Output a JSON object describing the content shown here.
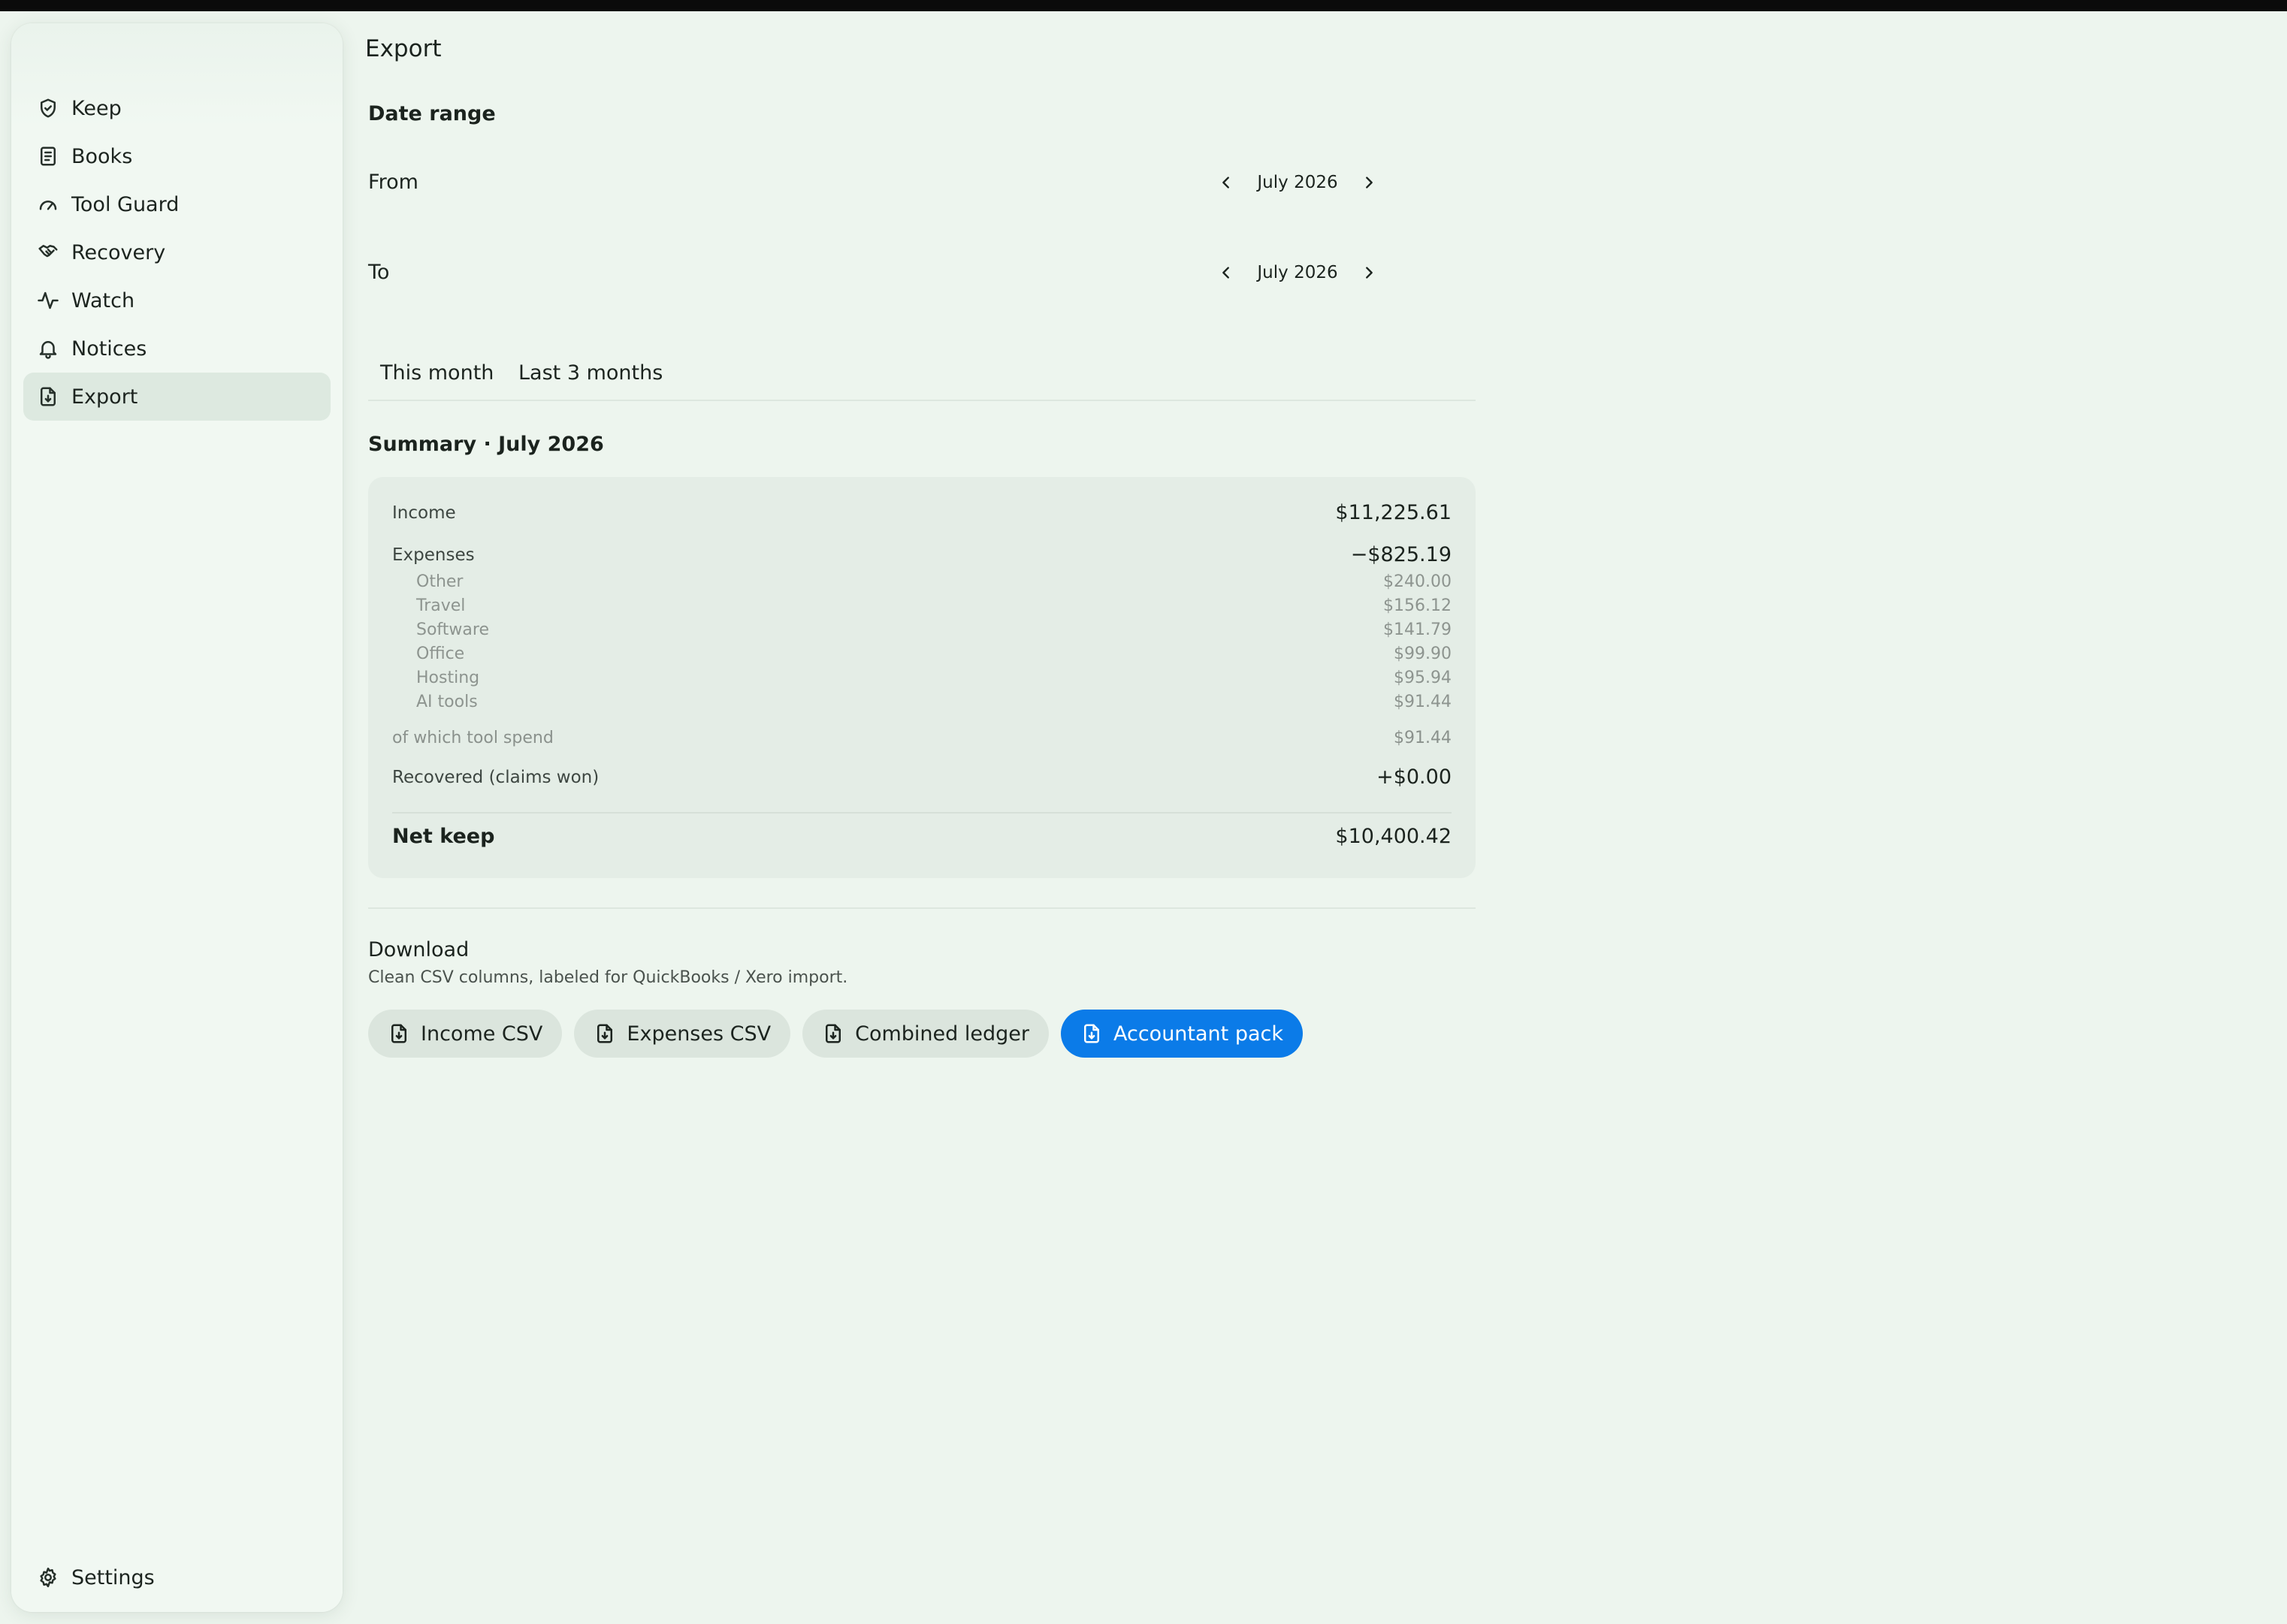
{
  "sidebar": {
    "items": [
      {
        "label": "Keep",
        "icon": "shield-check-icon"
      },
      {
        "label": "Books",
        "icon": "book-icon"
      },
      {
        "label": "Tool Guard",
        "icon": "gauge-icon"
      },
      {
        "label": "Recovery",
        "icon": "handshake-icon"
      },
      {
        "label": "Watch",
        "icon": "activity-icon"
      },
      {
        "label": "Notices",
        "icon": "bell-icon"
      },
      {
        "label": "Export",
        "icon": "file-download-icon",
        "active": true
      }
    ],
    "settings_label": "Settings"
  },
  "page": {
    "title": "Export"
  },
  "date_range": {
    "title": "Date range",
    "from_label": "From",
    "from_value": "July 2026",
    "to_label": "To",
    "to_value": "July 2026",
    "presets": [
      "This month",
      "Last 3 months"
    ]
  },
  "summary": {
    "title": "Summary · July 2026",
    "income_label": "Income",
    "income_value": "$11,225.61",
    "expenses_label": "Expenses",
    "expenses_value": "−$825.19",
    "categories": [
      {
        "label": "Other",
        "value": "$240.00"
      },
      {
        "label": "Travel",
        "value": "$156.12"
      },
      {
        "label": "Software",
        "value": "$141.79"
      },
      {
        "label": "Office",
        "value": "$99.90"
      },
      {
        "label": "Hosting",
        "value": "$95.94"
      },
      {
        "label": "AI tools",
        "value": "$91.44"
      }
    ],
    "tool_spend_label": "of which tool spend",
    "tool_spend_value": "$91.44",
    "recovered_label": "Recovered (claims won)",
    "recovered_value": "+$0.00",
    "net_label": "Net keep",
    "net_value": "$10,400.42"
  },
  "download": {
    "title": "Download",
    "subtitle": "Clean CSV columns, labeled for QuickBooks / Xero import.",
    "buttons": [
      "Income CSV",
      "Expenses CSV",
      "Combined ledger",
      "Accountant pack"
    ]
  },
  "colors": {
    "accent": "#0b7be8",
    "background": "#edf5ee",
    "active_nav": "#dde9e0"
  }
}
